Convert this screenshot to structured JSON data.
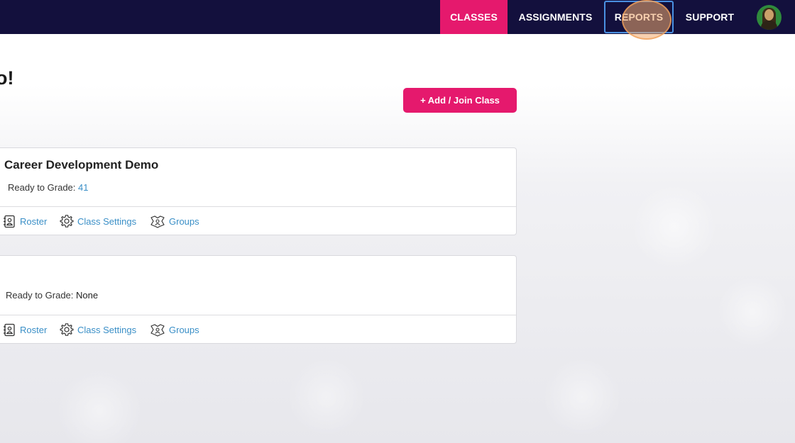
{
  "nav": {
    "items": [
      {
        "label": "CLASSES"
      },
      {
        "label": "ASSIGNMENTS"
      },
      {
        "label": "REPORTS"
      },
      {
        "label": "SUPPORT"
      }
    ],
    "active": "CLASSES",
    "focused": "REPORTS",
    "accent_color": "#e5196d",
    "bg_color": "#13103d"
  },
  "page": {
    "title_visible_fragment": "o!"
  },
  "actions": {
    "add_join_label": "+ Add / Join Class"
  },
  "classes": [
    {
      "name": "Career Development Demo",
      "ready_label": "Ready to Grade:",
      "ready_value": "41",
      "roster_label": "Roster",
      "settings_label": "Class Settings",
      "groups_label": "Groups"
    },
    {
      "name": "",
      "ready_label": "Ready to Grade:",
      "ready_value": "None",
      "roster_label": "Roster",
      "settings_label": "Class Settings",
      "groups_label": "Groups"
    }
  ],
  "icons": {
    "roster": "roster-icon",
    "settings": "gear-icon",
    "groups": "groups-icon",
    "avatar": "avatar"
  }
}
